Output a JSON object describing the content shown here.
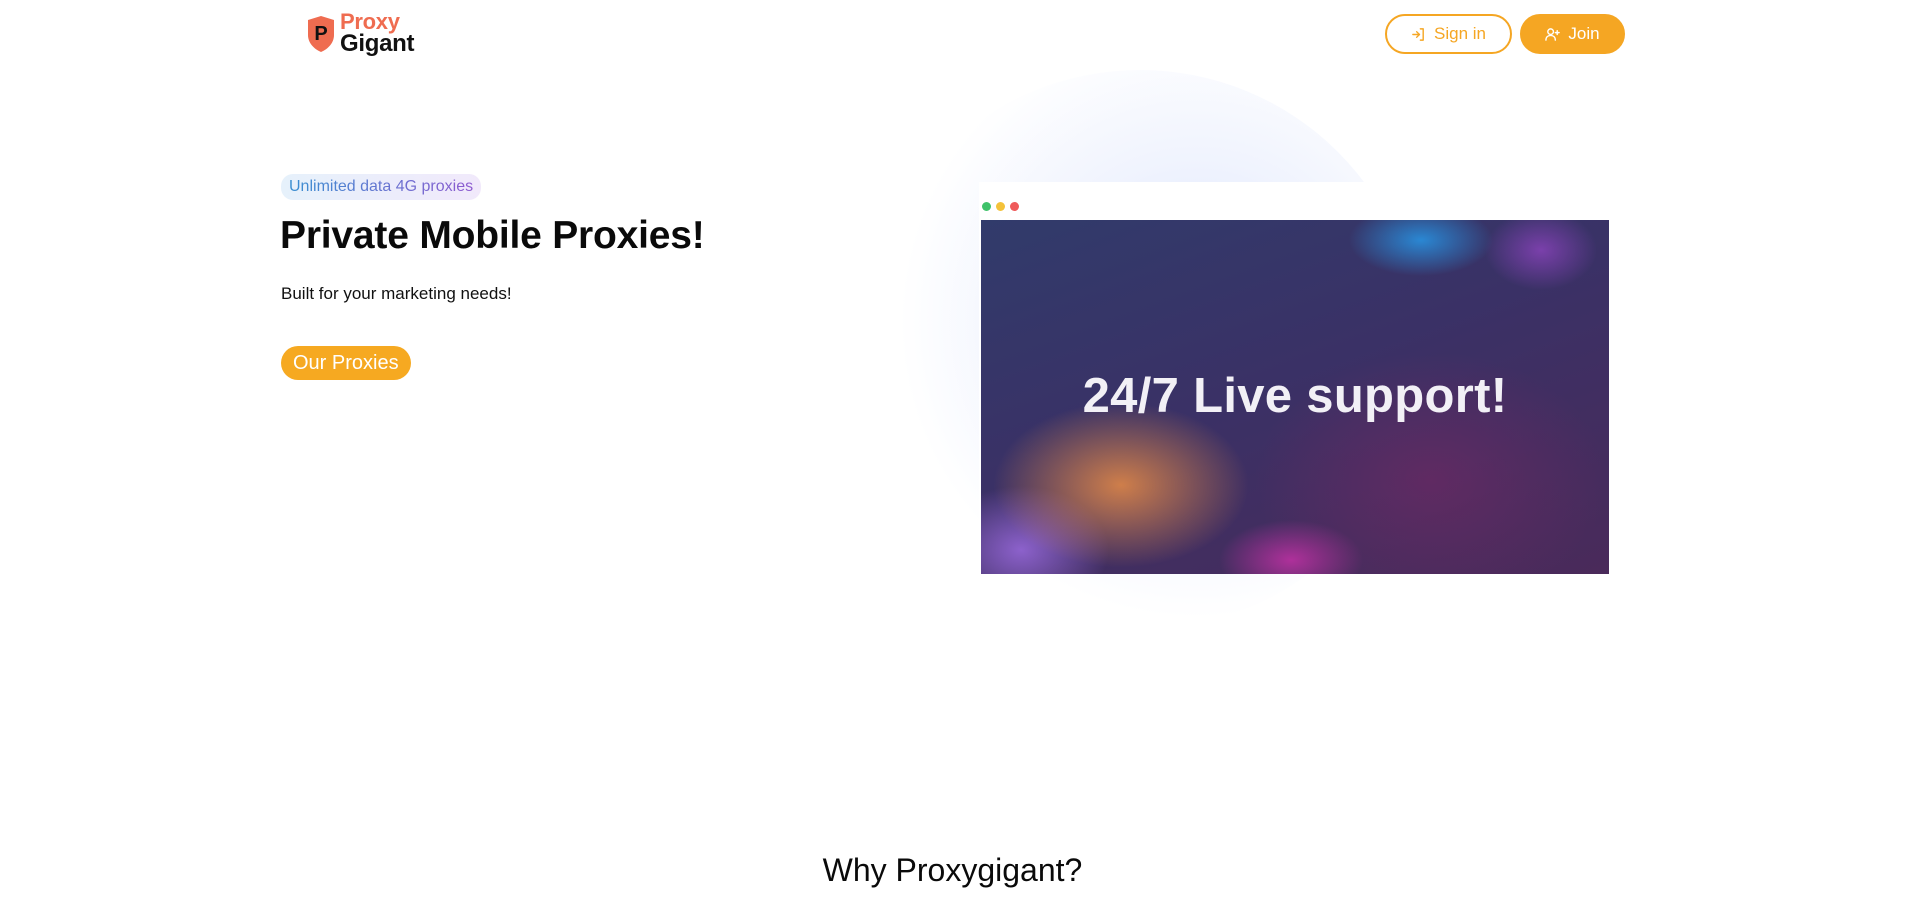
{
  "header": {
    "logo": {
      "line1": "Proxy",
      "line2": "Gigant",
      "mark_letter": "P"
    },
    "signin_label": "Sign in",
    "join_label": "Join"
  },
  "hero": {
    "badge": "Unlimited data 4G proxies",
    "title": "Private Mobile Proxies!",
    "subtitle": "Built for your marketing needs!",
    "cta_label": "Our Proxies",
    "banner_text": "24/7 Live support!"
  },
  "section": {
    "title": "Why Proxygigant?"
  },
  "colors": {
    "accent": "#f5a623",
    "logo_orange": "#ef6c50",
    "badge_blue": "#3a8fd1",
    "badge_purple": "#8e5bd0"
  },
  "icons": {
    "signin": "sign-in-icon",
    "join": "user-plus-icon"
  }
}
